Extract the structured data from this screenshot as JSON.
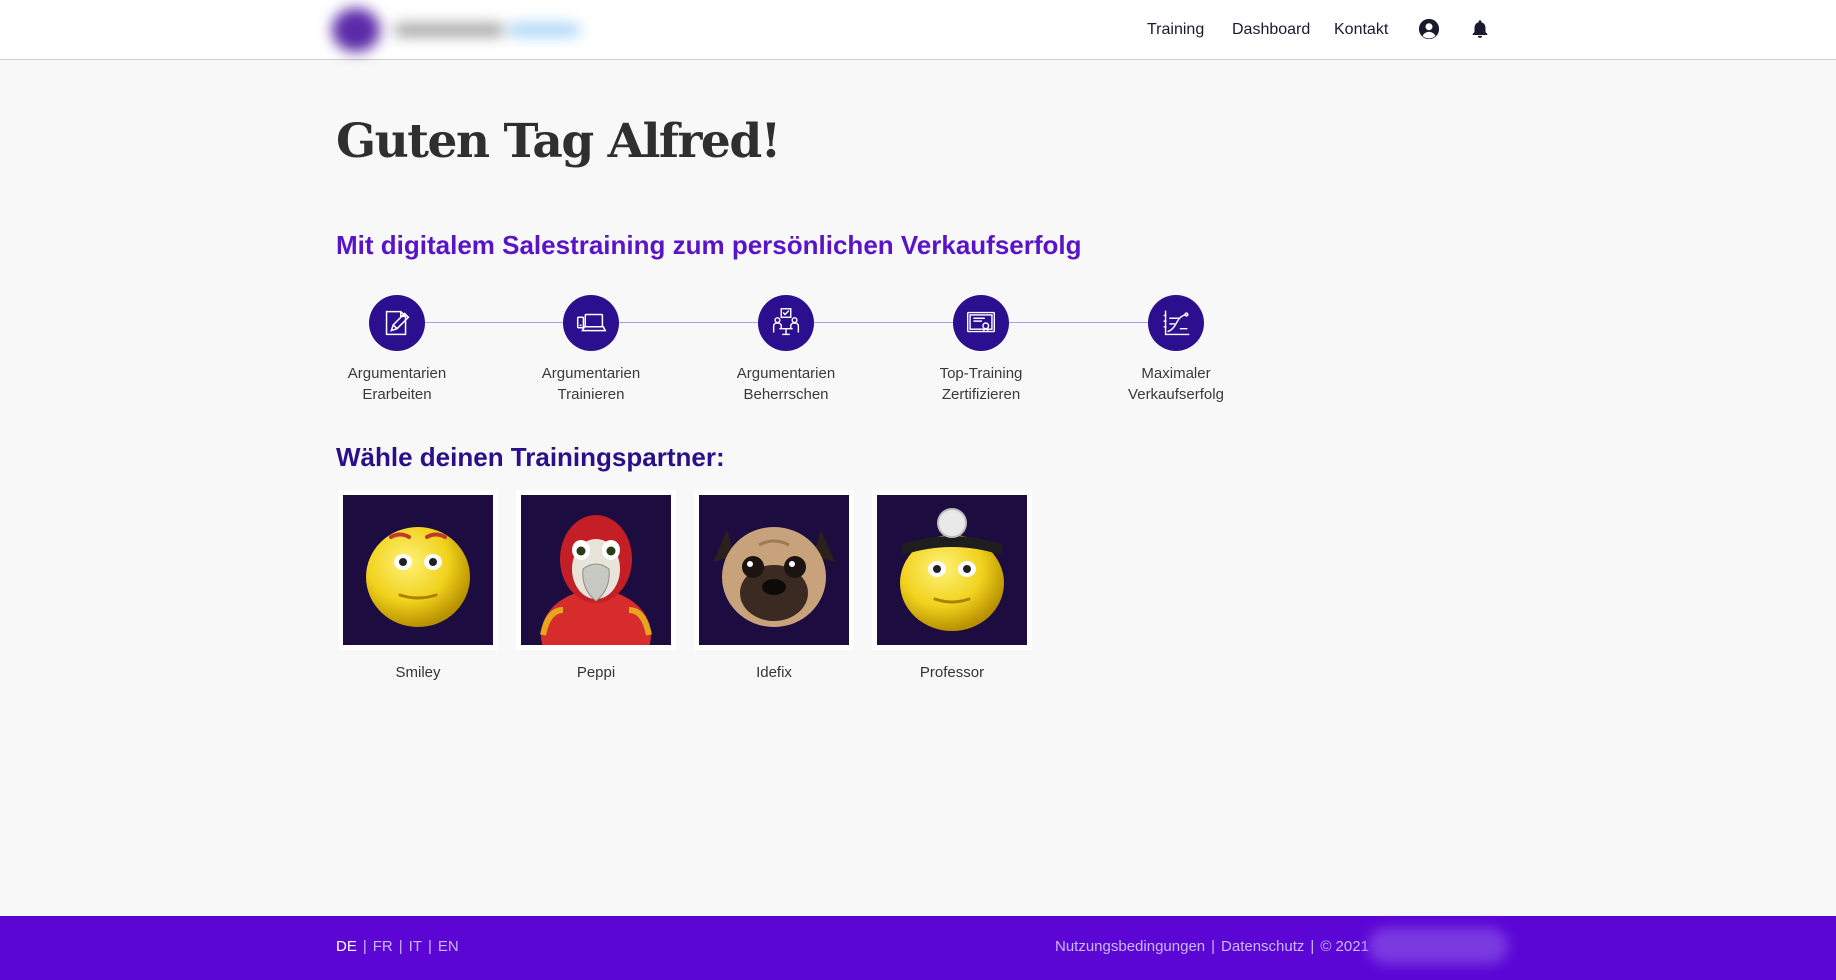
{
  "header": {
    "nav": [
      "Training",
      "Dashboard",
      "Kontakt"
    ],
    "icons": [
      "user-circle-icon",
      "bell-icon"
    ]
  },
  "main": {
    "greeting": "Guten Tag Alfred!",
    "subtitle": "Mit digitalem Salestraining zum persönlichen Verkaufserfolg",
    "steps": [
      {
        "line1": "Argumentarien",
        "line2": "Erarbeiten",
        "icon": "document-pencil-icon"
      },
      {
        "line1": "Argumentarien",
        "line2": "Trainieren",
        "icon": "laptop-phone-icon"
      },
      {
        "line1": "Argumentarien",
        "line2": "Beherrschen",
        "icon": "meeting-check-icon"
      },
      {
        "line1": "Top-Training",
        "line2": "Zertifizieren",
        "icon": "certificate-icon"
      },
      {
        "line1": "Maximaler",
        "line2": "Verkaufserfolg",
        "icon": "growth-chart-icon"
      }
    ],
    "partners_title": "Wähle deinen Trainingspartner:",
    "partners": [
      {
        "name": "Smiley",
        "icon": "smiley-avatar"
      },
      {
        "name": "Peppi",
        "icon": "parrot-avatar"
      },
      {
        "name": "Idefix",
        "icon": "pug-avatar"
      },
      {
        "name": "Professor",
        "icon": "professor-smiley-avatar"
      }
    ]
  },
  "footer": {
    "languages": [
      "DE",
      "FR",
      "IT",
      "EN"
    ],
    "active_language": "DE",
    "links": [
      "Nutzungsbedingungen",
      "Datenschutz"
    ],
    "copyright": "© 2021"
  },
  "colors": {
    "accent": "#5c06d6",
    "step_circle": "#2b0f8e",
    "subtitle": "#5a14c8",
    "card_bg": "#1c0c3f"
  }
}
